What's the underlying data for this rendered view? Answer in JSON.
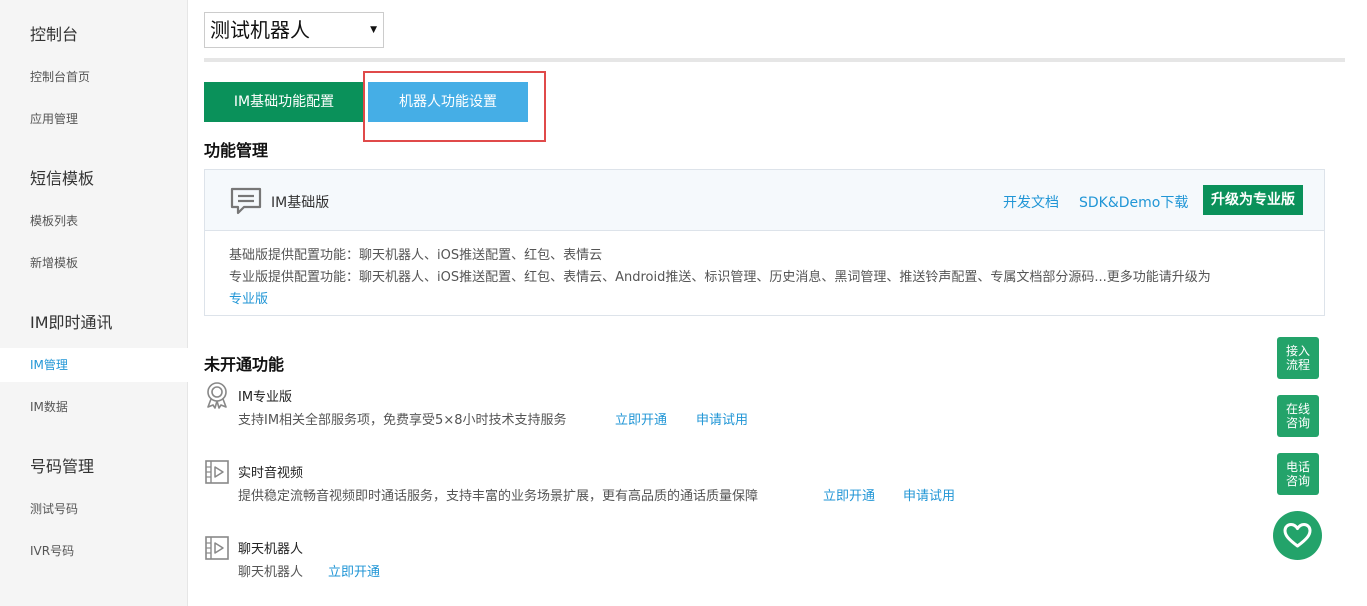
{
  "sidebar": {
    "sections": [
      {
        "title": "控制台",
        "items": [
          {
            "label": "控制台首页"
          },
          {
            "label": "应用管理"
          }
        ]
      },
      {
        "title": "短信模板",
        "items": [
          {
            "label": "模板列表"
          },
          {
            "label": "新增模板"
          }
        ]
      },
      {
        "title": "IM即时通讯",
        "items": [
          {
            "label": "IM管理",
            "active": true
          },
          {
            "label": "IM数据"
          }
        ]
      },
      {
        "title": "号码管理",
        "items": [
          {
            "label": "测试号码"
          },
          {
            "label": "IVR号码"
          }
        ]
      }
    ]
  },
  "header": {
    "robot_select_value": "测试机器人"
  },
  "tabs": [
    {
      "label": "IM基础功能配置"
    },
    {
      "label": "机器人功能设置"
    }
  ],
  "feature_management": {
    "title": "功能管理",
    "card": {
      "title": "IM基础版",
      "links": {
        "docs": "开发文档",
        "sdk": "SDK&Demo下载"
      },
      "upgrade_label": "升级为专业版",
      "basic_line": "基础版提供配置功能：聊天机器人、iOS推送配置、红包、表情云",
      "pro_line": "专业版提供配置功能：聊天机器人、iOS推送配置、红包、表情云、Android推送、标识管理、历史消息、黑词管理、推送铃声配置、专属文档部分源码...更多功能请升级为",
      "pro_link": "专业版"
    }
  },
  "inactive": {
    "title": "未开通功能",
    "items": [
      {
        "icon": "award-icon",
        "name": "IM专业版",
        "desc": "支持IM相关全部服务项，免费享受5×8小时技术支持服务",
        "open": "立即开通",
        "trial": "申请试用"
      },
      {
        "icon": "video-icon",
        "name": "实时音视频",
        "desc": "提供稳定流畅音视频即时通话服务，支持丰富的业务场景扩展，更有高品质的通话质量保障",
        "open": "立即开通",
        "trial": "申请试用"
      },
      {
        "icon": "video-icon",
        "name": "聊天机器人",
        "desc": "聊天机器人",
        "open": "立即开通"
      }
    ]
  },
  "floating": {
    "access": [
      "接入",
      "流程"
    ],
    "online": [
      "在线",
      "咨询"
    ],
    "phone": [
      "电话",
      "咨询"
    ],
    "heart_icon": "heart-icon"
  },
  "colors": {
    "primary_green": "#0a915a",
    "active_tab_blue": "#45aee6",
    "link_blue": "#2196d6",
    "highlight_red": "#e04a4a",
    "float_green": "#23a36a"
  }
}
